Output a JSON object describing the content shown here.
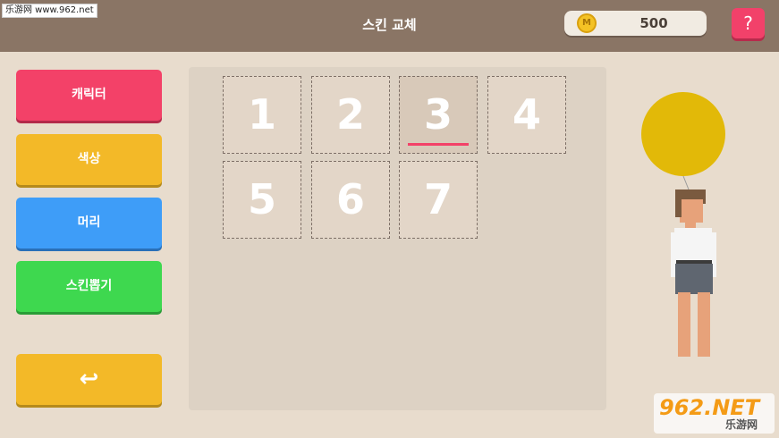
{
  "header": {
    "title": "스킨 교체",
    "watermark": "乐游网 www.962.net"
  },
  "coins": {
    "icon_letter": "M",
    "value": "500"
  },
  "help_label": "?",
  "menu": {
    "character": "캐릭터",
    "color": "색상",
    "hair": "머리",
    "skin_gacha": "스킨뽑기",
    "back_symbol": "↩"
  },
  "slots": [
    "1",
    "2",
    "3",
    "4",
    "5",
    "6",
    "7"
  ],
  "selected_slot": "3",
  "watermark_br": {
    "big": "962.NET",
    "small": "乐游网"
  },
  "colors": {
    "header": "#8a7565",
    "character_button": "#f34168",
    "color_button": "#f3b928",
    "hair_button": "#3e9df8",
    "gacha_button": "#3ed84f",
    "balloon": "#e2b908"
  }
}
